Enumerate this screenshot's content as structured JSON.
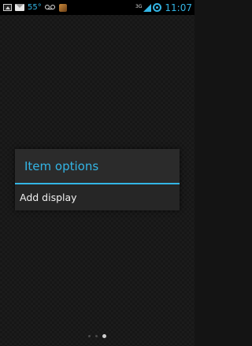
{
  "status_bar": {
    "temperature": "55°",
    "network": "3G",
    "time": "11:07",
    "icons": {
      "gallery": "gallery-icon",
      "mail": "mail-icon",
      "voicemail": "voicemail-icon",
      "app": "app-icon",
      "signal": "signal-icon",
      "battery": "battery-icon"
    }
  },
  "dialog": {
    "title": "Item options",
    "items": [
      {
        "label": "Add display"
      }
    ]
  },
  "pager": {
    "pages": 3,
    "current": 3
  },
  "colors": {
    "accent": "#33b5e5",
    "dialog_bg": "#282828",
    "background": "#161616"
  }
}
